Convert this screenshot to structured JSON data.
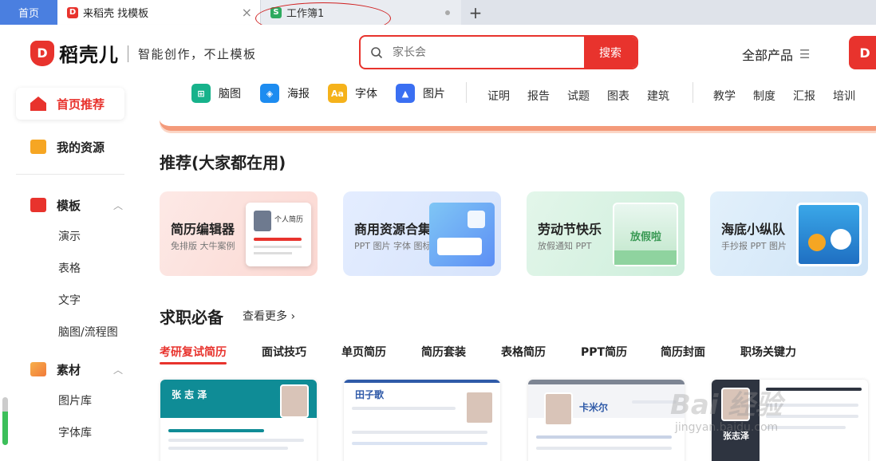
{
  "tabs": {
    "home": "首页",
    "active_tab": "来稻壳 找模板",
    "second_tab": "工作簿1"
  },
  "header": {
    "brand": "稻壳儿",
    "slogan": "智能创作，不止模板",
    "search_placeholder": "家长会",
    "search_button": "搜索",
    "all_products": "全部产品"
  },
  "sidebar": {
    "items": [
      {
        "label": "首页推荐"
      },
      {
        "label": "我的资源"
      },
      {
        "label": "模板"
      },
      {
        "label": "素材"
      }
    ],
    "template_subs": [
      "演示",
      "表格",
      "文字",
      "脑图/流程图"
    ],
    "material_subs": [
      "图片库",
      "字体库"
    ]
  },
  "categories": {
    "tools": [
      "脑图",
      "海报",
      "字体",
      "图片"
    ],
    "group1": [
      "证明",
      "报告",
      "试题",
      "图表",
      "建筑"
    ],
    "group2": [
      "教学",
      "制度",
      "汇报",
      "培训"
    ]
  },
  "recommend": {
    "title": "推荐(大家都在用)",
    "cards": [
      {
        "title": "简历编辑器",
        "sub": "免排版 大牛案例",
        "art_label": "个人简历"
      },
      {
        "title": "商用资源合集",
        "sub": "PPT 图片 字体 图标"
      },
      {
        "title": "劳动节快乐",
        "sub": "放假通知 PPT",
        "art_label": "放假啦"
      },
      {
        "title": "海底小纵队",
        "sub": "手抄报 PPT 图片"
      }
    ]
  },
  "jobs": {
    "title": "求职必备",
    "see_more": "查看更多",
    "tabs": [
      "考研复试简历",
      "面试技巧",
      "单页简历",
      "简历套装",
      "表格简历",
      "PPT简历",
      "简历封面",
      "职场关键力"
    ],
    "resumes": [
      {
        "name": "张 志 泽"
      },
      {
        "name": "田子歌"
      },
      {
        "name": "卡米尔"
      },
      {
        "name": "张志泽"
      }
    ]
  },
  "colors": {
    "brand_red": "#e8332d",
    "tab_blue": "#4a7fe0"
  }
}
